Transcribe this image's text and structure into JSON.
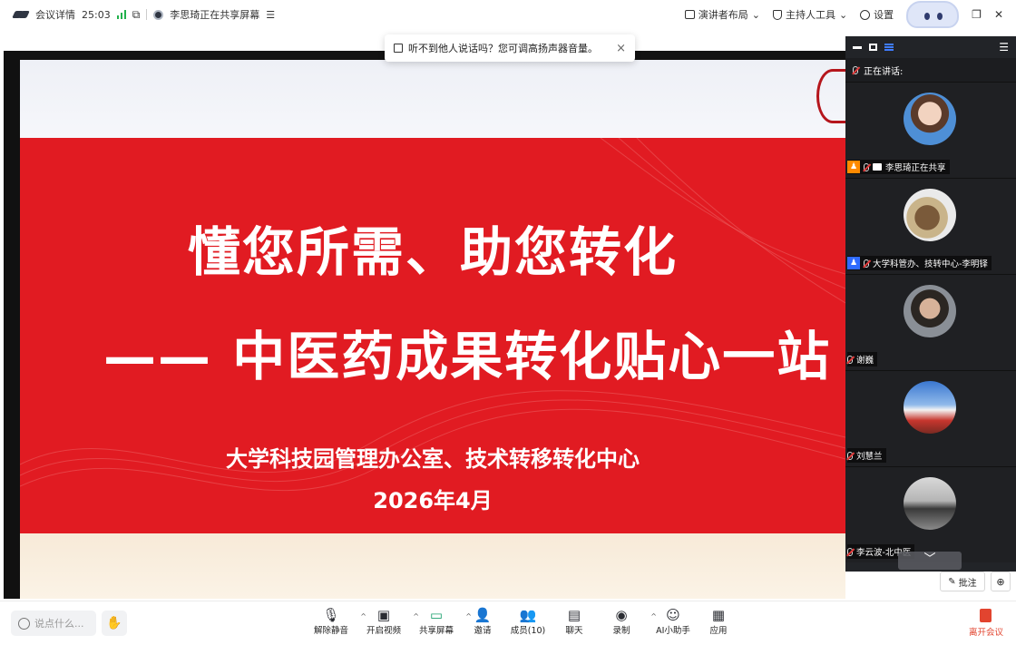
{
  "topbar": {
    "meeting_details": "会议详情",
    "duration": "25:03",
    "sharing_status": "李思琦正在共享屏幕",
    "sharing_menu": "☰",
    "layout_label": "演讲者布局",
    "host_tools_label": "主持人工具",
    "settings_label": "设置"
  },
  "toast": {
    "message": "听不到他人说话吗？您可调高扬声器音量。",
    "close": "×"
  },
  "slide": {
    "title_line1": "懂您所需、助您转化",
    "title_line2": "—— 中医药成果转化贴心一站",
    "org": "大学科技园管理办公室、技术转移转化中心",
    "date": "2026年4月"
  },
  "panel": {
    "speaking_label": "正在讲话:",
    "participants": [
      {
        "name": "李思琦正在共享",
        "role": "host-orange"
      },
      {
        "name": "大学科管办、技转中心-李明铎",
        "role": "host-blue"
      },
      {
        "name": "谢巍",
        "role": ""
      },
      {
        "name": "刘慧兰",
        "role": ""
      },
      {
        "name": "李云波-北中医",
        "role": ""
      }
    ],
    "collapse_glyph": "﹀"
  },
  "annotate": {
    "label": "批注"
  },
  "bottombar": {
    "chat_placeholder": "说点什么...",
    "tools": [
      {
        "label": "解除静音",
        "icon": "mic-muted-icon"
      },
      {
        "label": "开启视频",
        "icon": "camera-off-icon"
      },
      {
        "label": "共享屏幕",
        "icon": "share-screen-icon"
      },
      {
        "label": "邀请",
        "icon": "invite-icon"
      },
      {
        "label": "成员(10)",
        "icon": "members-icon"
      },
      {
        "label": "聊天",
        "icon": "chat-icon"
      },
      {
        "label": "录制",
        "icon": "record-icon"
      },
      {
        "label": "AI小助手",
        "icon": "ai-assistant-icon"
      },
      {
        "label": "应用",
        "icon": "apps-icon"
      }
    ],
    "leave_label": "离开会议"
  },
  "colors": {
    "slide_red": "#e11b22",
    "panel_bg": "#222428",
    "leave_red": "#e2442f",
    "signal_green": "#22b14c"
  }
}
